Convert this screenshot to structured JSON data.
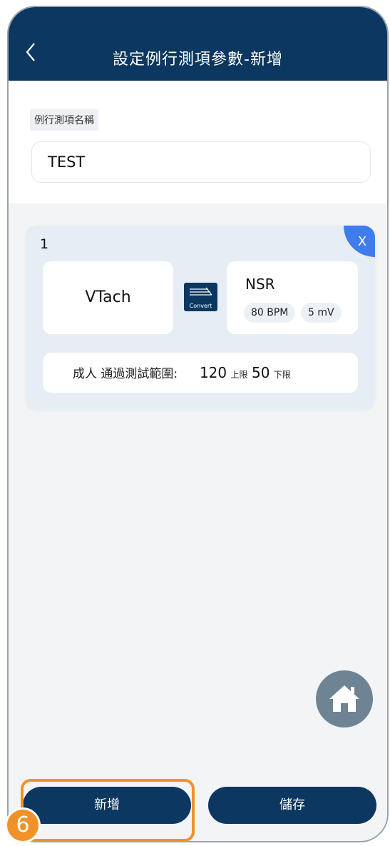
{
  "header": {
    "title": "設定例行測項參數-新增"
  },
  "form": {
    "name_label": "例行測項名稱",
    "name_value": "TEST"
  },
  "card": {
    "index": "1",
    "close_label": "X",
    "from_rhythm": "VTach",
    "convert_label": "Convert",
    "to_rhythm": "NSR",
    "to_rate": "80 BPM",
    "to_amplitude": "5 mV",
    "range_text": "成人 通過測試範圍:",
    "upper_value": "120",
    "upper_label": "上限",
    "lower_value": "50",
    "lower_label": "下限"
  },
  "buttons": {
    "add_label": "新增",
    "save_label": "儲存"
  },
  "annotation": {
    "step": "6"
  },
  "colors": {
    "header": "#0b3761",
    "accent": "#3f7cf0",
    "highlight": "#f0922a"
  }
}
